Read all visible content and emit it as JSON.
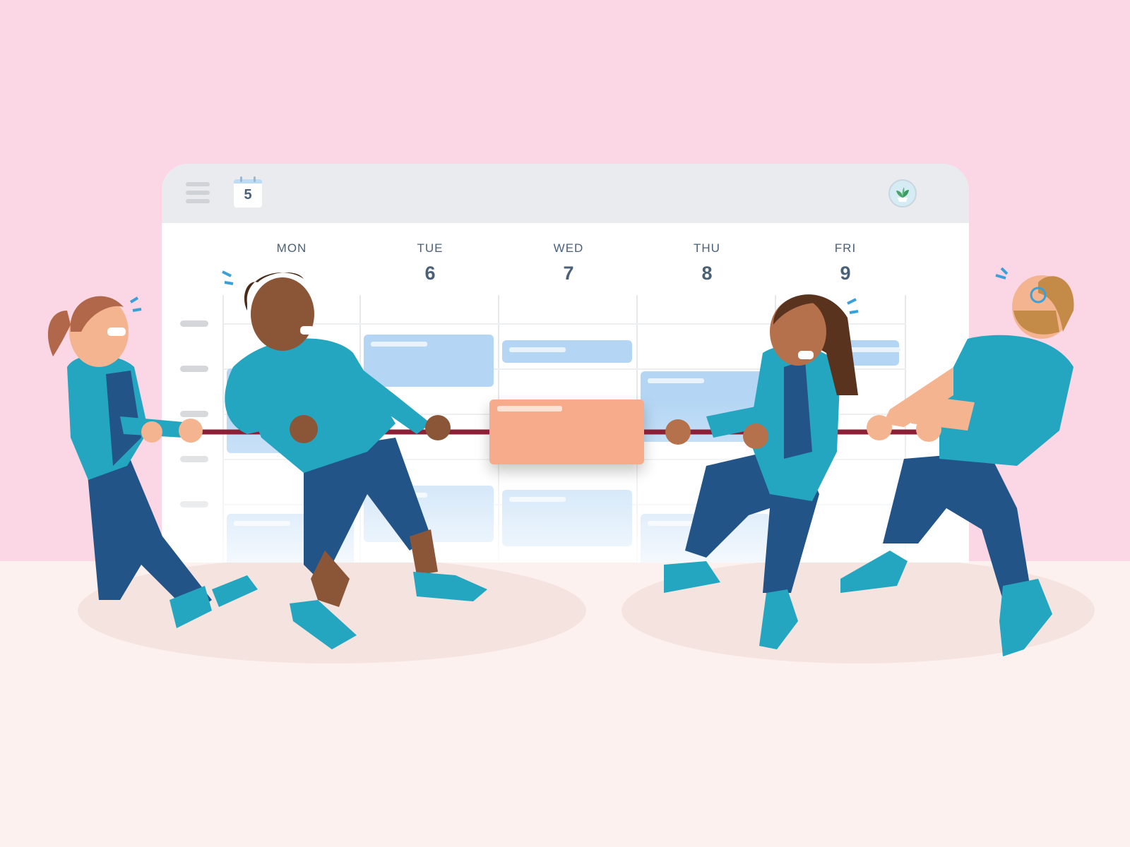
{
  "calendar": {
    "header_date": "5",
    "days": [
      {
        "name": "MON",
        "date": ""
      },
      {
        "name": "TUE",
        "date": "6"
      },
      {
        "name": "WED",
        "date": "7"
      },
      {
        "name": "THU",
        "date": "8"
      },
      {
        "name": "FRI",
        "date": "9"
      }
    ]
  },
  "icons": [
    "menu-icon",
    "calendar-icon",
    "plant-avatar-icon"
  ],
  "colors": {
    "background": "#fbd6e5",
    "floor": "#fcf1ef",
    "event_blue": "#b4d6f4",
    "contested_event": "#f8ab8a",
    "rope": "#8b2036",
    "clothing_teal": "#24a6c0",
    "clothing_navy": "#225487"
  }
}
